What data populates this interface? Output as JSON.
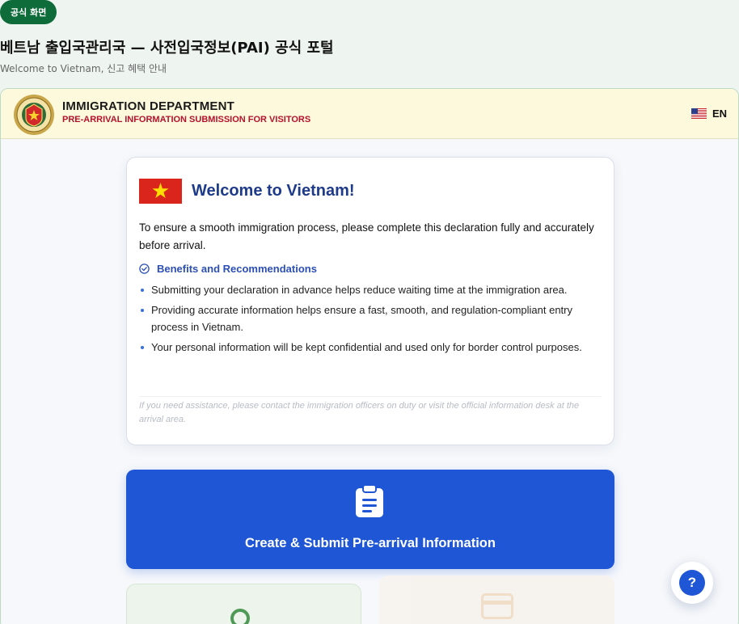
{
  "badge": "공식 화면",
  "page": {
    "title": "베트남 출입국관리국 — 사전입국정보(PAI) 공식 포털",
    "subtitle": "Welcome to Vietnam, 신고 혜택 안내"
  },
  "header": {
    "emblem_icon": "immigration-emblem-icon",
    "title": "IMMIGRATION DEPARTMENT",
    "subtitle": "PRE-ARRIVAL INFORMATION SUBMISSION FOR VISITORS",
    "language": "EN",
    "language_flag_icon": "us-flag-icon",
    "subtitle_color": "#b4122c"
  },
  "welcome": {
    "flag_icon": "vietnam-flag-icon",
    "title": "Welcome to Vietnam!",
    "intro": "To ensure a smooth immigration process, please complete this declaration fully and accurately before arrival.",
    "benefits_icon": "check-circle-icon",
    "benefits_title": "Benefits and Recommendations",
    "benefits": [
      "Submitting your declaration in advance helps reduce waiting time at the immigration area.",
      "Providing accurate information helps ensure a fast, smooth, and regulation-compliant entry process in Vietnam.",
      "Your personal information will be kept confidential and used only for border control purposes."
    ],
    "note": "If you need assistance, please contact the immigration officers on duty or visit the official information desk at the arrival area."
  },
  "cta": {
    "icon": "clipboard-icon",
    "label": "Create & Submit Pre-arrival Information",
    "color": "#1e56d6"
  },
  "tiles": [
    {
      "icon": "search-icon",
      "color": "#4f9a56"
    },
    {
      "icon": "credit-card-icon",
      "color": "#f0dcc4"
    }
  ],
  "help": {
    "icon": "question-icon",
    "label": "?"
  }
}
